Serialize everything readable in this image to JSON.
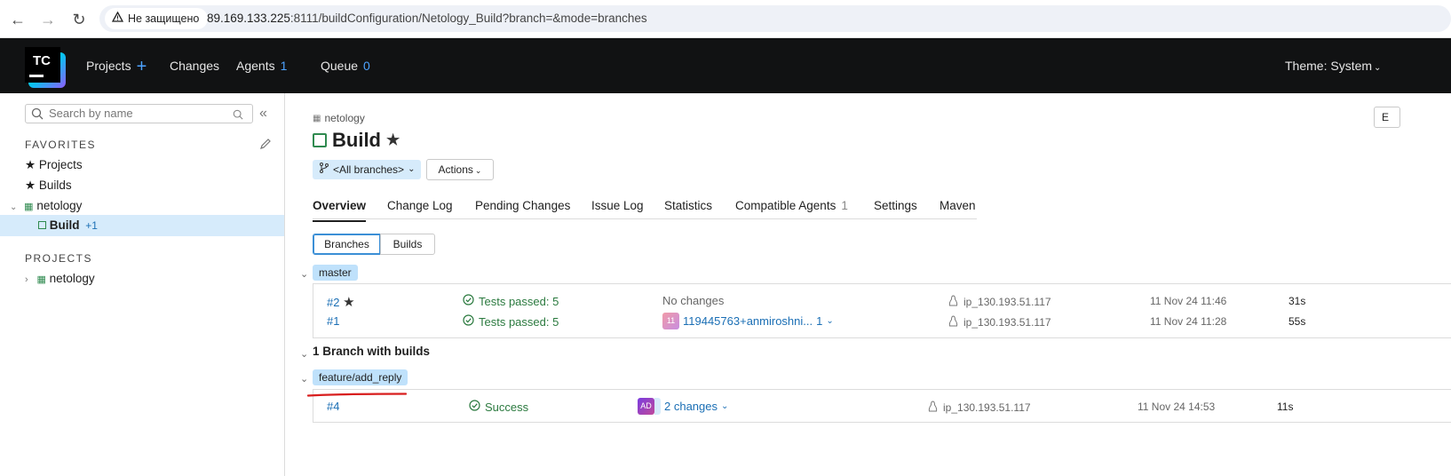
{
  "browser": {
    "security_label": "Не защищено",
    "url_host": "89.169.133.225",
    "url_rest": ":8111/buildConfiguration/Netology_Build?branch=&mode=branches"
  },
  "header": {
    "logo_text": "TC",
    "projects": "Projects",
    "changes": "Changes",
    "agents": "Agents",
    "agents_count": "1",
    "queue": "Queue",
    "queue_count": "0",
    "theme": "Theme: System"
  },
  "sidebar": {
    "search_placeholder": "Search by name",
    "favorites_title": "FAVORITES",
    "fav_projects": "Projects",
    "fav_builds": "Builds",
    "fav_project": "netology",
    "fav_build": "Build",
    "fav_build_badge": "+1",
    "projects_title": "PROJECTS",
    "project": "netology"
  },
  "main": {
    "breadcrumb": "netology",
    "title": "Build",
    "top_right_btn": "E",
    "branch_selector": "<All branches>",
    "actions": "Actions",
    "tabs": [
      {
        "label": "Overview"
      },
      {
        "label": "Change Log"
      },
      {
        "label": "Pending Changes"
      },
      {
        "label": "Issue Log"
      },
      {
        "label": "Statistics"
      },
      {
        "label": "Compatible Agents",
        "count": "1"
      },
      {
        "label": "Settings"
      },
      {
        "label": "Maven"
      }
    ],
    "seg_branches": "Branches",
    "seg_builds": "Builds",
    "master_branch": "master",
    "master_builds": [
      {
        "num": "#2",
        "status": "Tests passed: 5",
        "changes": "No changes",
        "agent": "ip_130.193.51.117",
        "date": "11 Nov 24 11:46",
        "duration": "31s"
      },
      {
        "num": "#1",
        "status": "Tests passed: 5",
        "changes": "119445763+anmiroshni...",
        "changes_count": "1",
        "avatar": "11",
        "agent": "ip_130.193.51.117",
        "date": "11 Nov 24 11:28",
        "duration": "55s"
      }
    ],
    "group_title": "1 Branch with builds",
    "feature_branch": "feature/add_reply",
    "feature_build": {
      "num": "#4",
      "status": "Success",
      "changes": "2 changes",
      "avatar": "AD",
      "agent": "ip_130.193.51.117",
      "date": "11 Nov 24 14:53",
      "duration": "11s"
    }
  },
  "colors": {
    "accent": "#4da3ff",
    "success": "#2b7a3f",
    "link": "#1b6fb5",
    "branch_chip": "#bfe1fb",
    "annotation": "#d81e1e"
  }
}
